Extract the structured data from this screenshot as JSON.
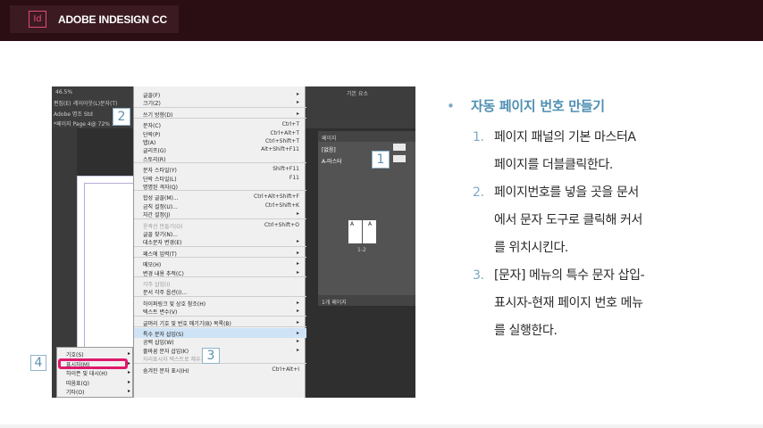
{
  "header": {
    "app_icon": "Id",
    "title": "ADOBE INDESIGN CC",
    "bg_color": "#2a0e14",
    "accent": "#e44a7a"
  },
  "screenshot": {
    "toolbar_texts": [
      "46.5%",
      "편집(E)",
      "레이아웃(L)",
      "문자(T)",
      "기본 요소",
      "Adobe 명조 Std",
      "(8pt)",
      "L",
      "0%",
      "*페이지 Page 4@ 72% 1",
      "50"
    ],
    "menu_items": [
      {
        "label": "글꼴(F)",
        "shortcut": "",
        "arrow": true
      },
      {
        "label": "크기(Z)",
        "shortcut": "",
        "arrow": true
      },
      {
        "label": "",
        "sep": true
      },
      {
        "label": "쓰기 방향(D)",
        "shortcut": "",
        "arrow": true
      },
      {
        "label": "",
        "sep": true
      },
      {
        "label": "문자(C)",
        "shortcut": "Ctrl+T"
      },
      {
        "label": "단락(P)",
        "shortcut": "Ctrl+Alt+T"
      },
      {
        "label": "탭(A)",
        "shortcut": "Ctrl+Shift+T"
      },
      {
        "label": "글리프(G)",
        "shortcut": "Alt+Shift+F11"
      },
      {
        "label": "스토리(R)",
        "shortcut": ""
      },
      {
        "label": "",
        "sep": true
      },
      {
        "label": "문자 스타일(Y)",
        "shortcut": "Shift+F11"
      },
      {
        "label": "단락 스타일(L)",
        "shortcut": "F11"
      },
      {
        "label": "명명된 격자(Q)",
        "shortcut": ""
      },
      {
        "label": "",
        "sep": true
      },
      {
        "label": "합성 글꼴(M)...",
        "shortcut": "Ctrl+Alt+Shift+F"
      },
      {
        "label": "금칙 설정(U)...",
        "shortcut": "Ctrl+Shift+K"
      },
      {
        "label": "자간 설정(J)",
        "shortcut": "",
        "arrow": true
      },
      {
        "label": "",
        "sep": true
      },
      {
        "label": "윤곽선 만들기(O)",
        "shortcut": "Ctrl+Shift+O",
        "disabled": true
      },
      {
        "label": "글꼴 찾기(N)...",
        "shortcut": ""
      },
      {
        "label": "대소문자 변경(E)",
        "shortcut": "",
        "arrow": true
      },
      {
        "label": "",
        "sep": true
      },
      {
        "label": "패스에 입력(T)",
        "shortcut": "",
        "arrow": true
      },
      {
        "label": "",
        "sep": true
      },
      {
        "label": "메모(H)",
        "shortcut": "",
        "arrow": true
      },
      {
        "label": "변경 내용 추적(C)",
        "shortcut": "",
        "arrow": true
      },
      {
        "label": "",
        "sep": true
      },
      {
        "label": "각주 삽입(I)",
        "shortcut": "",
        "disabled": true
      },
      {
        "label": "문서 각주 옵션(I)...",
        "shortcut": ""
      },
      {
        "label": "",
        "sep": true
      },
      {
        "label": "하이퍼링크 및 상호 참조(H)",
        "shortcut": "",
        "arrow": true
      },
      {
        "label": "텍스트 변수(V)",
        "shortcut": "",
        "arrow": true
      },
      {
        "label": "",
        "sep": true
      },
      {
        "label": "글머리 기호 및 번호 매기기(B) 목록(B)",
        "shortcut": "",
        "arrow": true
      },
      {
        "label": "",
        "sep": true
      },
      {
        "label": "특수 문자 삽입(S)",
        "shortcut": "",
        "arrow": true,
        "selected": true
      },
      {
        "label": "공백 삽입(W)",
        "shortcut": "",
        "arrow": true
      },
      {
        "label": "줄바꿈 문자 삽입(K)",
        "shortcut": "",
        "arrow": true
      },
      {
        "label": "자리표시자 텍스트로 채우기(M)",
        "shortcut": "",
        "disabled": true
      },
      {
        "label": "",
        "sep": true
      },
      {
        "label": "숨겨진 문자 표시(H)",
        "shortcut": "Ctrl+Alt+I"
      }
    ],
    "submenu_items": [
      "기호(S)",
      "표시자(M)",
      "하이픈 및 대시(H)",
      "따옴표(Q)",
      "기타(O)"
    ],
    "pages_panel": {
      "tab": "페이지",
      "items": [
        "[없음]",
        "A-마스터"
      ],
      "spread_labels": [
        "A",
        "A"
      ],
      "spread_number": "1-2",
      "footer": "1개 페이지"
    },
    "callouts": [
      "1",
      "2",
      "3",
      "4"
    ],
    "highlight_color": "#e0196c"
  },
  "instructions": {
    "heading": "자동 페이지 번호 만들기",
    "steps": [
      {
        "num": "1.",
        "text": "페이지 패널의 기본 마스터A\n페이지를 더블클릭한다."
      },
      {
        "num": "2.",
        "text": "페이지번호를 넣을 곳을 문서\n에서 문자 도구로 클릭해 커서\n를 위치시킨다."
      },
      {
        "num": "3.",
        "text": "[문자] 메뉴의 특수 문자 삽입-\n표시자-현재 페이지 번호 메뉴\n를 실행한다."
      }
    ]
  }
}
